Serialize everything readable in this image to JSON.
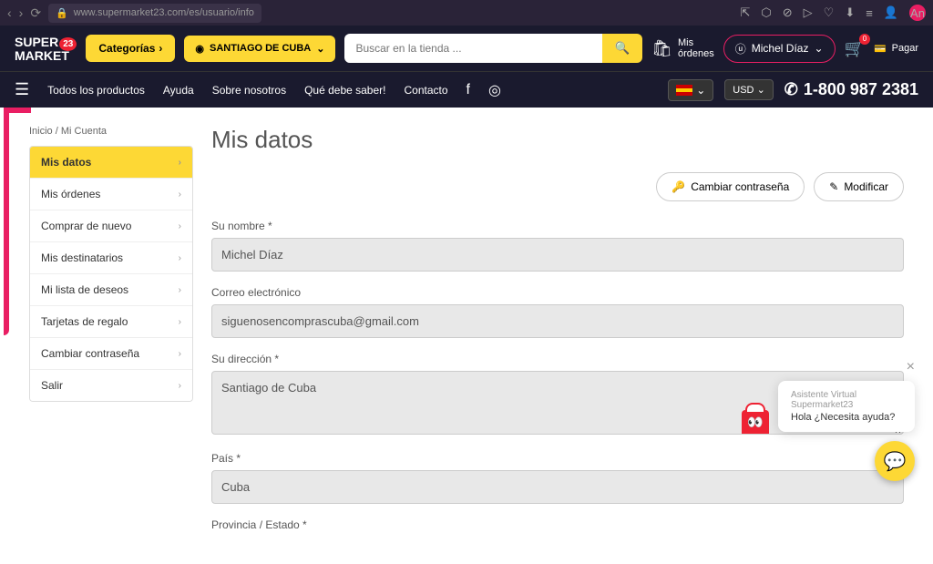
{
  "browser": {
    "url": "www.supermarket23.com/es/usuario/info"
  },
  "header": {
    "logo_top": "SUPER",
    "logo_bottom": "MARKET",
    "logo_num": "23",
    "categories": "Categorías",
    "location": "SANTIAGO DE CUBA",
    "search_placeholder": "Buscar en la tienda ...",
    "my_orders_top": "Mis",
    "my_orders_bottom": "órdenes",
    "user_name": "Michel Díaz",
    "cart_count": "0",
    "pay": "Pagar"
  },
  "nav": {
    "all_products": "Todos los productos",
    "help": "Ayuda",
    "about": "Sobre nosotros",
    "must_know": "Qué debe saber!",
    "contact": "Contacto",
    "currency": "USD",
    "phone": "1-800 987 2381"
  },
  "breadcrumb": {
    "home": "Inicio",
    "sep": " / ",
    "current": "Mi Cuenta"
  },
  "sidebar": {
    "items": [
      {
        "label": "Mis datos"
      },
      {
        "label": "Mis órdenes"
      },
      {
        "label": "Comprar de nuevo"
      },
      {
        "label": "Mis destinatarios"
      },
      {
        "label": "Mi lista de deseos"
      },
      {
        "label": "Tarjetas de regalo"
      },
      {
        "label": "Cambiar contraseña"
      },
      {
        "label": "Salir"
      }
    ]
  },
  "page": {
    "title": "Mis datos",
    "change_password": "Cambiar contraseña",
    "modify": "Modificar"
  },
  "form": {
    "name_label": "Su nombre *",
    "name_value": "Michel Díaz",
    "email_label": "Correo electrónico",
    "email_value": "siguenosencomprascuba@gmail.com",
    "address_label": "Su dirección *",
    "address_value": "Santiago de Cuba",
    "country_label": "País *",
    "country_value": "Cuba",
    "province_label": "Provincia / Estado *"
  },
  "chat": {
    "title": "Asistente Virtual Supermarket23",
    "message": "Hola ¿Necesita ayuda?"
  }
}
